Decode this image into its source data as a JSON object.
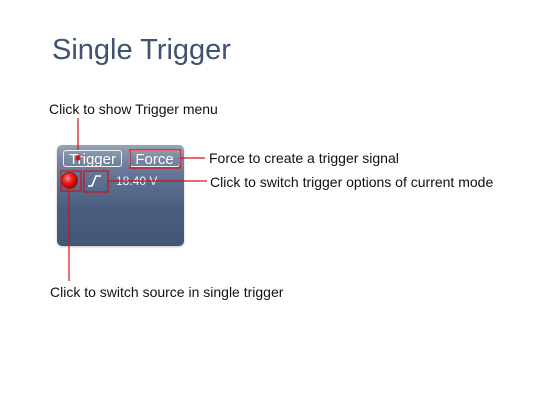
{
  "title": "Single Trigger",
  "annotations": {
    "trigger_menu": "Click to show Trigger menu",
    "force": "Force to create a trigger signal",
    "switch_options": "Click to switch trigger options of current mode",
    "switch_source": "Click to switch source in single trigger"
  },
  "panel": {
    "trigger_label": "Trigger",
    "force_label": "Force",
    "trigger_level": "18.40 V",
    "source_color": "#e01b1b",
    "edge_icon": "rising-edge-icon"
  },
  "colors": {
    "title": "#3f5270",
    "callout": "#d0101a",
    "panel": "#4f6284"
  }
}
